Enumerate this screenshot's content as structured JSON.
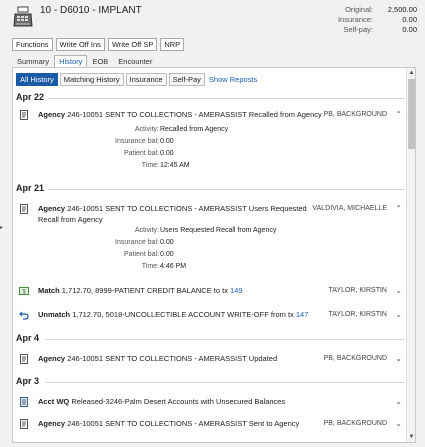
{
  "header": {
    "title": "10 - D6010 - IMPLANT",
    "totals": [
      {
        "label": "Original:",
        "value": "2,500.00"
      },
      {
        "label": "Insurance:",
        "value": "0.00"
      },
      {
        "label": "Self-pay:",
        "value": "0.00"
      }
    ]
  },
  "actions": [
    "Functions",
    "Write Off Ins",
    "Write Off SP",
    "NRP"
  ],
  "tabs": [
    "Summary",
    "History",
    "EOB",
    "Encounter"
  ],
  "active_tab": "History",
  "subtabs": [
    "All History",
    "Matching History",
    "Insurance",
    "Self-Pay"
  ],
  "active_subtab": "All History",
  "show_reposts": "Show Reposts",
  "groups": [
    {
      "date": "Apr 22",
      "entries": [
        {
          "kind": "Agency",
          "text": "246-10051 SENT TO COLLECTIONS - AMERASSIST Recalled from Agency",
          "user": "PB, BACKGROUND",
          "expanded": true,
          "details": [
            {
              "label": "Activity:",
              "value": "Recalled from Agency"
            },
            {
              "label": "Insurance bal:",
              "value": "0.00"
            },
            {
              "label": "Patient bal:",
              "value": "0.00"
            },
            {
              "label": "Time:",
              "value": "12:45 AM"
            }
          ]
        }
      ]
    },
    {
      "date": "Apr 21",
      "entries": [
        {
          "kind": "Agency",
          "text": "246-10051 SENT TO COLLECTIONS - AMERASSIST Users Requested",
          "text2": "Recall from Agency",
          "user": "VALDIVIA, MICHAELLE",
          "expanded": true,
          "details": [
            {
              "label": "Activity:",
              "value": "Users Requested Recall from Agency"
            },
            {
              "label": "Insurance bal:",
              "value": "0.00"
            },
            {
              "label": "Patient bal:",
              "value": "0.00"
            },
            {
              "label": "Time:",
              "value": "4:46 PM"
            }
          ]
        },
        {
          "kind": "Match",
          "text": "1,712.70, 8999-PATIENT CREDIT BALANCE to tx",
          "link": "149",
          "user": "TAYLOR, KIRSTIN"
        },
        {
          "kind": "Unmatch",
          "text": "1,712.70, 5018-UNCOLLECTIBLE ACCOUNT WRITE-OFF from tx",
          "link": "147",
          "user": "TAYLOR, KIRSTIN"
        }
      ]
    },
    {
      "date": "Apr 4",
      "entries": [
        {
          "kind": "Agency",
          "text": "246-10051 SENT TO COLLECTIONS - AMERASSIST Updated",
          "user": "PB, BACKGROUND"
        }
      ]
    },
    {
      "date": "Apr 3",
      "entries": [
        {
          "kind": "Acct WQ",
          "text": "Released-3246-Palm Desert Accounts with Unsecured Balances",
          "user": ""
        },
        {
          "kind": "Agency",
          "text": "246-10051 SENT TO COLLECTIONS - AMERASSIST Sent to Agency",
          "user": "PB, BACKGROUND"
        }
      ]
    }
  ]
}
